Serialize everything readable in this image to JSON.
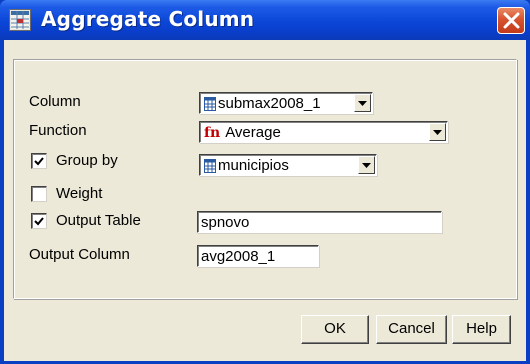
{
  "window": {
    "title": "Aggregate Column"
  },
  "icons": {
    "app": "table-grid-icon",
    "close": "close-icon",
    "table": "table-icon",
    "function": "fn-icon",
    "dropdown": "chevron-down-icon",
    "check": "checkmark-icon"
  },
  "form": {
    "column": {
      "label": "Column",
      "value": "submax2008_1"
    },
    "function": {
      "label": "Function",
      "icon_text": "fn",
      "value": "Average"
    },
    "group_by": {
      "label": "Group by",
      "checked": true,
      "value": "municipios"
    },
    "weight": {
      "label": "Weight",
      "checked": false
    },
    "output_table": {
      "label": "Output Table",
      "checked": true,
      "value": "spnovo"
    },
    "output_column": {
      "label": "Output Column",
      "value": "avg2008_1"
    }
  },
  "buttons": {
    "ok": "OK",
    "cancel": "Cancel",
    "help": "Help"
  },
  "colors": {
    "title_bar": "#0a3fc4",
    "dialog_bg": "#ece9d8",
    "close_button": "#d8532f",
    "fn_icon": "#c00000"
  }
}
